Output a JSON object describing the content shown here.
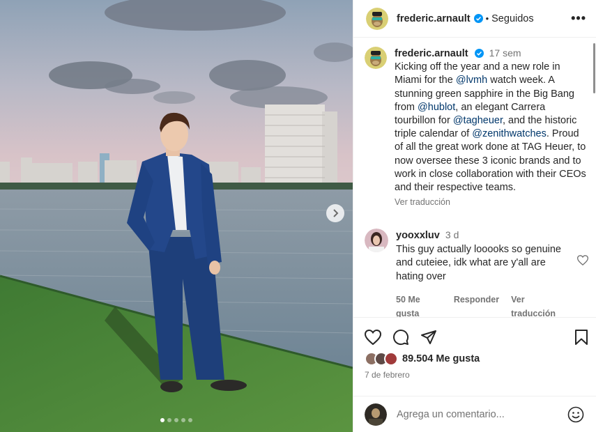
{
  "post": {
    "username": "frederic.arnault",
    "separator": "•",
    "follow_status": "Seguidos",
    "more_label": "•••",
    "caption_time": "17 sem",
    "caption_parts": [
      "Kicking off the year and a new role in Miami for the ",
      "@lvmh",
      " watch week. A stunning green sapphire in the Big Bang from ",
      "@hublot",
      ", an elegant Carrera tourbillon for ",
      "@tagheuer",
      ", and the historic triple calendar of ",
      "@zenithwatches",
      ". Proud of all the great work done at TAG Heuer, to now oversee these 3 iconic brands and to work in close collaboration with their CEOs and their respective teams."
    ],
    "see_translation": "Ver traducción"
  },
  "comment": {
    "username": "yooxxluv",
    "time": "3 d",
    "text": "This guy actually looooks so genuine and cuteiee, idk what are y'all are hating over",
    "likes": "50 Me gusta",
    "reply": "Responder",
    "see_translation": "Ver traducción"
  },
  "stats": {
    "likes_count": "89.504",
    "likes_suffix": "Me gusta",
    "date": "7 de febrero"
  },
  "composer": {
    "placeholder": "Agrega un comentario..."
  },
  "carousel": {
    "slide_count": 5,
    "active_index": 0
  },
  "colors": {
    "link": "#00376b",
    "verified": "#0095f6",
    "secondary_text": "#737373"
  },
  "icons": [
    "verified-badge-icon",
    "more-options-icon",
    "chevron-right-icon",
    "heart-icon",
    "comment-icon",
    "share-icon",
    "bookmark-icon",
    "emoji-icon"
  ]
}
